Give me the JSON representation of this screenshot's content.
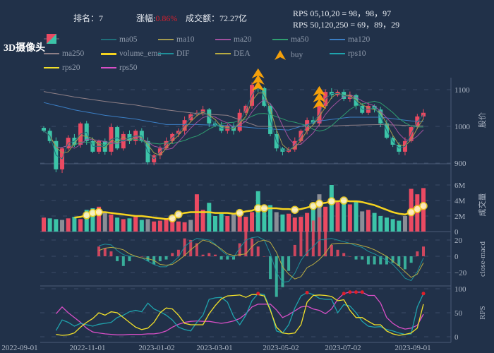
{
  "header": {
    "rank_label": "排名：",
    "rank_value": "7",
    "change_label": "涨幅:",
    "change_value": "0.86%",
    "turnover_label": "成交额：",
    "turnover_value": "72.27亿",
    "rps_line1": "RPS 05,10,20 = 98，98，97",
    "rps_line2": "RPS 50,120,250 = 69，89，29"
  },
  "title": "3D摄像头",
  "colors": {
    "background": "#213149",
    "up": "#eb4a62",
    "down": "#3cc4a8",
    "neutral": "#8b8d96",
    "ma05": "#1f6f7a",
    "ma10": "#a39a4e",
    "ma20": "#a0509e",
    "ma50": "#2f9e70",
    "ma120": "#3b7ec4",
    "ma250": "#8e7f86",
    "volume_ema": "#f5d31f",
    "DIF": "#1f8f9a",
    "DEA": "#b8ab42",
    "buy": "#f5a00a",
    "rps10": "#1fa3ad",
    "rps20": "#f2e02a",
    "rps50": "#d94fc7",
    "rps_highlight": "#e0202a"
  },
  "legend": [
    {
      "key": "candle",
      "label": "",
      "icon": "candlestick-icon"
    },
    {
      "key": "ma05",
      "label": "ma05"
    },
    {
      "key": "ma10",
      "label": "ma10"
    },
    {
      "key": "ma20",
      "label": "ma20"
    },
    {
      "key": "ma50",
      "label": "ma50"
    },
    {
      "key": "ma120",
      "label": "ma120"
    },
    {
      "key": "ma250",
      "label": "ma250"
    },
    {
      "key": "volume_ema",
      "label": "volume_ema"
    },
    {
      "key": "DIF",
      "label": "DIF"
    },
    {
      "key": "DEA",
      "label": "DEA"
    },
    {
      "key": "buy",
      "label": "buy",
      "icon": "buy-arrow-icon"
    },
    {
      "key": "rps10",
      "label": "rps10"
    },
    {
      "key": "rps20",
      "label": "rps20"
    },
    {
      "key": "rps50",
      "label": "rps50"
    }
  ],
  "chart_data": {
    "type": "candlestick-multi-panel",
    "x_ticks": [
      "2022-09-01",
      "2022-11-01",
      "2023-01-02",
      "2023-03-01",
      "2023-05-02",
      "2023-07-02",
      "2023-09-01"
    ],
    "grid": true,
    "panels": {
      "price": {
        "ylabel": "股价",
        "ylim": [
          870,
          1130
        ],
        "yticks": [
          "900",
          "1000",
          "1100"
        ]
      },
      "volume": {
        "ylabel": "成交量",
        "ylim": [
          0,
          6
        ],
        "yticks": [
          "0",
          "2M",
          "4M",
          "6M"
        ]
      },
      "macd": {
        "ylabel": "close-macd",
        "ylim": [
          -37,
          30
        ],
        "yticks": [
          "−20",
          "0",
          "20"
        ]
      },
      "rps": {
        "ylabel": "RPS",
        "ylim": [
          0,
          100
        ],
        "yticks": [
          "0",
          "50",
          "100"
        ]
      }
    },
    "close": [
      988,
      960,
      883,
      940,
      969,
      950,
      1008,
      960,
      931,
      960,
      931,
      998,
      940,
      979,
      960,
      988,
      960,
      902,
      921,
      940,
      960,
      979,
      988,
      1017,
      1033,
      1037,
      1046,
      1008,
      1002,
      988,
      1002,
      988,
      1037,
      1056,
      1113,
      1104,
      1056,
      979,
      940,
      931,
      937,
      960,
      988,
      1017,
      1008,
      1056,
      1094,
      1085,
      1094,
      1075,
      1085,
      1056,
      1037,
      1056,
      1046,
      1008,
      969,
      950,
      931,
      960,
      998,
      1027,
      1037
    ],
    "ma120_every5": [
      1065,
      1045,
      1030,
      1020,
      1005,
      1005,
      1002,
      995,
      990,
      1015,
      1025,
      1025,
      1015,
      1010
    ],
    "ma250_every5": [
      1095,
      1080,
      1068,
      1058,
      1045,
      1035,
      1030,
      1000,
      1000,
      1000,
      1003,
      1005,
      1002,
      1000
    ],
    "buy_signals": [
      35,
      45
    ],
    "volume_M": [
      1.8,
      1.7,
      1.6,
      1.5,
      1.7,
      1.9,
      1.6,
      2.8,
      3.0,
      3.2,
      2.5,
      2.2,
      1.8,
      1.6,
      1.7,
      1.9,
      1.5,
      1.6,
      1.3,
      1.4,
      1.7,
      1.6,
      1.3,
      1.2,
      1.5,
      4.8,
      2.8,
      3.7,
      2.0,
      2.3,
      2.0,
      2.4,
      2.0,
      1.9,
      2.5,
      5.2,
      2.5,
      3.4,
      2.5,
      2.2,
      2.3,
      1.8,
      1.9,
      2.4,
      3.5,
      4.8,
      3.2,
      6.0,
      3.8,
      4.0,
      3.5,
      3.8,
      2.6,
      2.8,
      2.4,
      2.0,
      1.8,
      1.6,
      1.4,
      2.0,
      5.5,
      4.8,
      5.6
    ],
    "volume_ema_M": [
      null,
      null,
      null,
      null,
      null,
      1.8,
      1.9,
      2.1,
      2.4,
      2.5,
      2.5,
      2.4,
      2.3,
      2.2,
      2.1,
      2.0,
      2.0,
      1.9,
      1.8,
      1.7,
      1.6,
      1.7,
      2.2,
      2.4,
      2.5,
      2.5,
      2.5,
      2.5,
      2.4,
      2.4,
      2.4,
      2.3,
      2.4,
      2.6,
      2.7,
      3.0,
      3.0,
      3.0,
      3.0,
      2.9,
      2.9,
      2.8,
      2.9,
      3.1,
      3.3,
      3.6,
      3.7,
      3.9,
      3.9,
      4.0,
      3.9,
      3.9,
      3.8,
      3.6,
      3.4,
      3.1,
      2.8,
      2.5,
      2.3,
      2.2,
      2.5,
      2.9,
      3.3
    ],
    "volume_ema_markers": [
      7,
      8,
      9,
      21,
      22,
      32,
      35,
      36,
      41,
      44,
      45,
      47,
      49,
      60,
      61,
      62
    ],
    "DIF": [
      null,
      null,
      null,
      null,
      null,
      null,
      null,
      null,
      null,
      13,
      15,
      14,
      7,
      2,
      0,
      0,
      -2,
      -6,
      -10,
      -13,
      -13,
      -8,
      -1,
      12,
      18,
      22,
      21,
      20,
      15,
      7,
      1,
      -1,
      10,
      20,
      23,
      24,
      20,
      3,
      -20,
      -32,
      -31,
      -21,
      -5,
      5,
      12,
      20,
      21,
      22,
      20,
      18,
      16,
      13,
      11,
      6,
      3,
      -1,
      -5,
      -10,
      -18,
      -27,
      -30,
      -19,
      -2
    ],
    "DEA": [
      null,
      null,
      null,
      null,
      null,
      null,
      null,
      null,
      null,
      7,
      10,
      11,
      10,
      8,
      3,
      0,
      -2,
      -3,
      -5,
      -10,
      -11,
      -10,
      -5,
      1,
      8,
      14,
      20,
      18,
      14,
      9,
      3,
      1,
      2,
      3,
      12,
      18,
      20,
      17,
      5,
      -13,
      -22,
      -28,
      -25,
      -14,
      -10,
      -4,
      4,
      15,
      16,
      16,
      16,
      15,
      13,
      11,
      8,
      4,
      0,
      -6,
      -12,
      -19,
      -26,
      -22,
      -8
    ],
    "rps10": [
      null,
      null,
      13,
      35,
      30,
      22,
      28,
      25,
      22,
      26,
      28,
      30,
      40,
      45,
      52,
      55,
      52,
      70,
      58,
      52,
      45,
      35,
      20,
      15,
      12,
      30,
      45,
      78,
      81,
      82,
      72,
      42,
      25,
      45,
      75,
      90,
      88,
      58,
      12,
      8,
      25,
      60,
      85,
      92,
      88,
      80,
      78,
      78,
      50,
      67,
      64,
      50,
      32,
      22,
      20,
      21,
      15,
      12,
      8,
      5,
      6,
      62,
      90
    ],
    "rps20": [
      null,
      null,
      5,
      3,
      4,
      8,
      20,
      30,
      38,
      50,
      45,
      52,
      50,
      40,
      30,
      20,
      15,
      18,
      30,
      50,
      60,
      58,
      45,
      28,
      25,
      25,
      25,
      48,
      65,
      79,
      85,
      86,
      87,
      82,
      88,
      88,
      85,
      55,
      20,
      8,
      6,
      8,
      25,
      72,
      86,
      87,
      86,
      84,
      75,
      77,
      55,
      40,
      40,
      32,
      25,
      25,
      12,
      6,
      3,
      5,
      8,
      18,
      68
    ],
    "rps50": [
      null,
      null,
      48,
      62,
      50,
      40,
      30,
      18,
      10,
      8,
      6,
      5,
      4,
      4,
      5,
      5,
      5,
      6,
      6,
      8,
      12,
      20,
      26,
      30,
      32,
      33,
      32,
      32,
      30,
      28,
      30,
      33,
      38,
      48,
      62,
      68,
      68,
      68,
      56,
      40,
      46,
      54,
      62,
      64,
      58,
      55,
      48,
      58,
      78,
      90,
      93,
      93,
      93,
      86,
      86,
      70,
      40,
      28,
      20,
      16,
      18,
      24,
      47
    ]
  }
}
